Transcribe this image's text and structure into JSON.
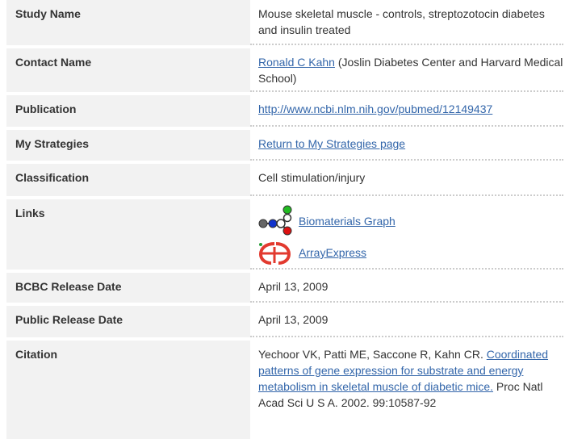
{
  "rows": {
    "study": {
      "label": "Study Name",
      "value": "Mouse skeletal muscle - controls, streptozotocin diabetes and insulin treated"
    },
    "contact": {
      "label": "Contact Name",
      "link": "Ronald C Kahn",
      "rest": " (Joslin Diabetes Center and Harvard Medical School)"
    },
    "publication": {
      "label": "Publication",
      "link": "http://www.ncbi.nlm.nih.gov/pubmed/12149437"
    },
    "strategies": {
      "label": "My Strategies",
      "link": "Return to My Strategies page"
    },
    "classification": {
      "label": "Classification",
      "value": "Cell stimulation/injury"
    },
    "links": {
      "label": "Links",
      "graph_link": "Biomaterials Graph",
      "arrayexpress_link": "ArrayExpress"
    },
    "bcbc_date": {
      "label": "BCBC Release Date",
      "value": "April 13, 2009"
    },
    "public_date": {
      "label": "Public Release Date",
      "value": "April 13, 2009"
    },
    "citation": {
      "label": "Citation",
      "authors": "Yechoor VK, Patti ME, Saccone R, Kahn CR.",
      "title_link": "Coordinated patterns of gene expression for substrate and energy metabolism in skeletal muscle of diabetic mice.",
      "journal": " Proc Natl Acad Sci U S A. 2002. 99:10587-92"
    }
  },
  "icons": {
    "graph": "biomaterials-graph-icon",
    "arrayexpress": "arrayexpress-logo-icon"
  },
  "colors": {
    "label_bg": "#f2f2f2",
    "link": "#3366aa",
    "graph_green": "#22bb22",
    "graph_blue": "#1133cc",
    "graph_red": "#dd1111",
    "arrayexpress_red": "#e23a2f"
  }
}
